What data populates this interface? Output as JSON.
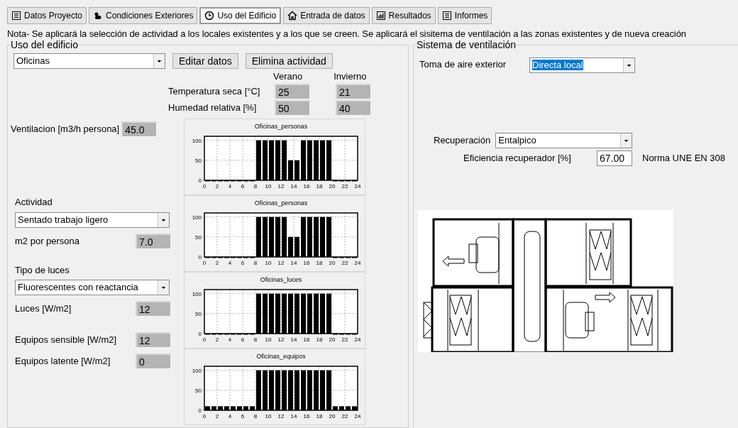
{
  "tabs": [
    {
      "label": "Datos Proyecto",
      "selected": false
    },
    {
      "label": "Condiciones Exteriores",
      "selected": false
    },
    {
      "label": "Uso del Edificio",
      "selected": true
    },
    {
      "label": "Entrada de datos",
      "selected": false
    },
    {
      "label": "Resultados",
      "selected": false
    },
    {
      "label": "Informes",
      "selected": false
    }
  ],
  "note": "Nota- Se aplicará la selección de actividad a los locales existentes y a los que se creen. Se aplicará el sisitema de ventilación a las zonas existentes y de nueva creación",
  "uso": {
    "title": "Uso del edificio",
    "activity_select": "Oficinas",
    "buttons": [
      "Editar datos",
      "Elimina actividad"
    ],
    "col_headers": [
      "Verano",
      "Invierno"
    ],
    "conditions": [
      {
        "label": "Temperatura seca [°C]",
        "values": [
          "25",
          "21"
        ]
      },
      {
        "label": "Humedad relativa [%]",
        "values": [
          "50",
          "40"
        ]
      }
    ],
    "ventilation": {
      "label": "Ventilacion [m3/h persona]",
      "value": "45.0"
    },
    "actividad": {
      "label": "Actividad",
      "select": "Sentado trabajo ligero",
      "field_label": "m2 por persona",
      "value": "7.0"
    },
    "luces": {
      "label": "Tipo de luces",
      "select": "Fluorescentes con reactancia",
      "field_label": "Luces [W/m2]",
      "value": "12"
    },
    "equipos": [
      {
        "label": "Equipos sensible [W/m2]",
        "value": "12"
      },
      {
        "label": "Equipos latente [W/m2]",
        "value": "0"
      }
    ],
    "charts": [
      {
        "chart_data": {
          "type": "bar",
          "title": "Oficinas_personas",
          "x": [
            0.5,
            1.5,
            2.5,
            3.5,
            4.5,
            5.5,
            6.5,
            7.5,
            8.5,
            9.5,
            10.5,
            11.5,
            12.5,
            13.5,
            14.5,
            15.5,
            16.5,
            17.5,
            18.5,
            19.5,
            20.5,
            21.5,
            22.5,
            23.5
          ],
          "values": [
            0,
            0,
            0,
            0,
            0,
            0,
            0,
            0,
            100,
            100,
            100,
            100,
            100,
            50,
            50,
            100,
            100,
            100,
            100,
            100,
            0,
            0,
            0,
            0
          ],
          "xlim": [
            0,
            24
          ],
          "ylim": [
            0,
            110
          ],
          "xticks": [
            0,
            2,
            4,
            6,
            8,
            10,
            12,
            14,
            16,
            18,
            20,
            22,
            24
          ],
          "yticks": [
            0,
            50,
            100
          ],
          "grid": true
        }
      },
      {
        "chart_data": {
          "type": "bar",
          "title": "Oficinas_personas",
          "x": [
            0.5,
            1.5,
            2.5,
            3.5,
            4.5,
            5.5,
            6.5,
            7.5,
            8.5,
            9.5,
            10.5,
            11.5,
            12.5,
            13.5,
            14.5,
            15.5,
            16.5,
            17.5,
            18.5,
            19.5,
            20.5,
            21.5,
            22.5,
            23.5
          ],
          "values": [
            0,
            0,
            0,
            0,
            0,
            0,
            0,
            0,
            100,
            100,
            100,
            100,
            100,
            50,
            50,
            100,
            100,
            100,
            100,
            100,
            0,
            0,
            0,
            0
          ],
          "xlim": [
            0,
            24
          ],
          "ylim": [
            0,
            110
          ],
          "xticks": [
            0,
            2,
            4,
            6,
            8,
            10,
            12,
            14,
            16,
            18,
            20,
            22,
            24
          ],
          "yticks": [
            0,
            50,
            100
          ],
          "grid": true
        }
      },
      {
        "chart_data": {
          "type": "bar",
          "title": "Oficinas_luces",
          "x": [
            0.5,
            1.5,
            2.5,
            3.5,
            4.5,
            5.5,
            6.5,
            7.5,
            8.5,
            9.5,
            10.5,
            11.5,
            12.5,
            13.5,
            14.5,
            15.5,
            16.5,
            17.5,
            18.5,
            19.5,
            20.5,
            21.5,
            22.5,
            23.5
          ],
          "values": [
            0,
            0,
            0,
            0,
            0,
            0,
            0,
            0,
            100,
            100,
            100,
            100,
            100,
            100,
            100,
            100,
            100,
            100,
            100,
            100,
            0,
            0,
            0,
            0
          ],
          "xlim": [
            0,
            24
          ],
          "ylim": [
            0,
            110
          ],
          "xticks": [
            0,
            2,
            4,
            6,
            8,
            10,
            12,
            14,
            16,
            18,
            20,
            22,
            24
          ],
          "yticks": [
            0,
            50,
            100
          ],
          "grid": true
        }
      },
      {
        "chart_data": {
          "type": "bar",
          "title": "Oficinas_equipos",
          "x": [
            0.5,
            1.5,
            2.5,
            3.5,
            4.5,
            5.5,
            6.5,
            7.5,
            8.5,
            9.5,
            10.5,
            11.5,
            12.5,
            13.5,
            14.5,
            15.5,
            16.5,
            17.5,
            18.5,
            19.5,
            20.5,
            21.5,
            22.5,
            23.5
          ],
          "values": [
            10,
            10,
            10,
            10,
            10,
            10,
            10,
            10,
            100,
            100,
            100,
            100,
            100,
            100,
            100,
            100,
            100,
            100,
            100,
            100,
            10,
            10,
            10,
            10
          ],
          "xlim": [
            0,
            24
          ],
          "ylim": [
            0,
            110
          ],
          "xticks": [
            0,
            2,
            4,
            6,
            8,
            10,
            12,
            14,
            16,
            18,
            20,
            22,
            24
          ],
          "yticks": [
            0,
            50,
            100
          ],
          "grid": true
        }
      }
    ]
  },
  "ventilacion": {
    "title": "Sistema de ventilación",
    "toma": {
      "label": "Toma de aire exterior",
      "select": "Directa local"
    },
    "recuperacion": {
      "label": "Recuperación",
      "select": "Entalpico"
    },
    "eficiencia": {
      "label": "Eficiencia recuperador  [%]",
      "value": "67.00",
      "note": "Norma UNE EN 308"
    }
  }
}
